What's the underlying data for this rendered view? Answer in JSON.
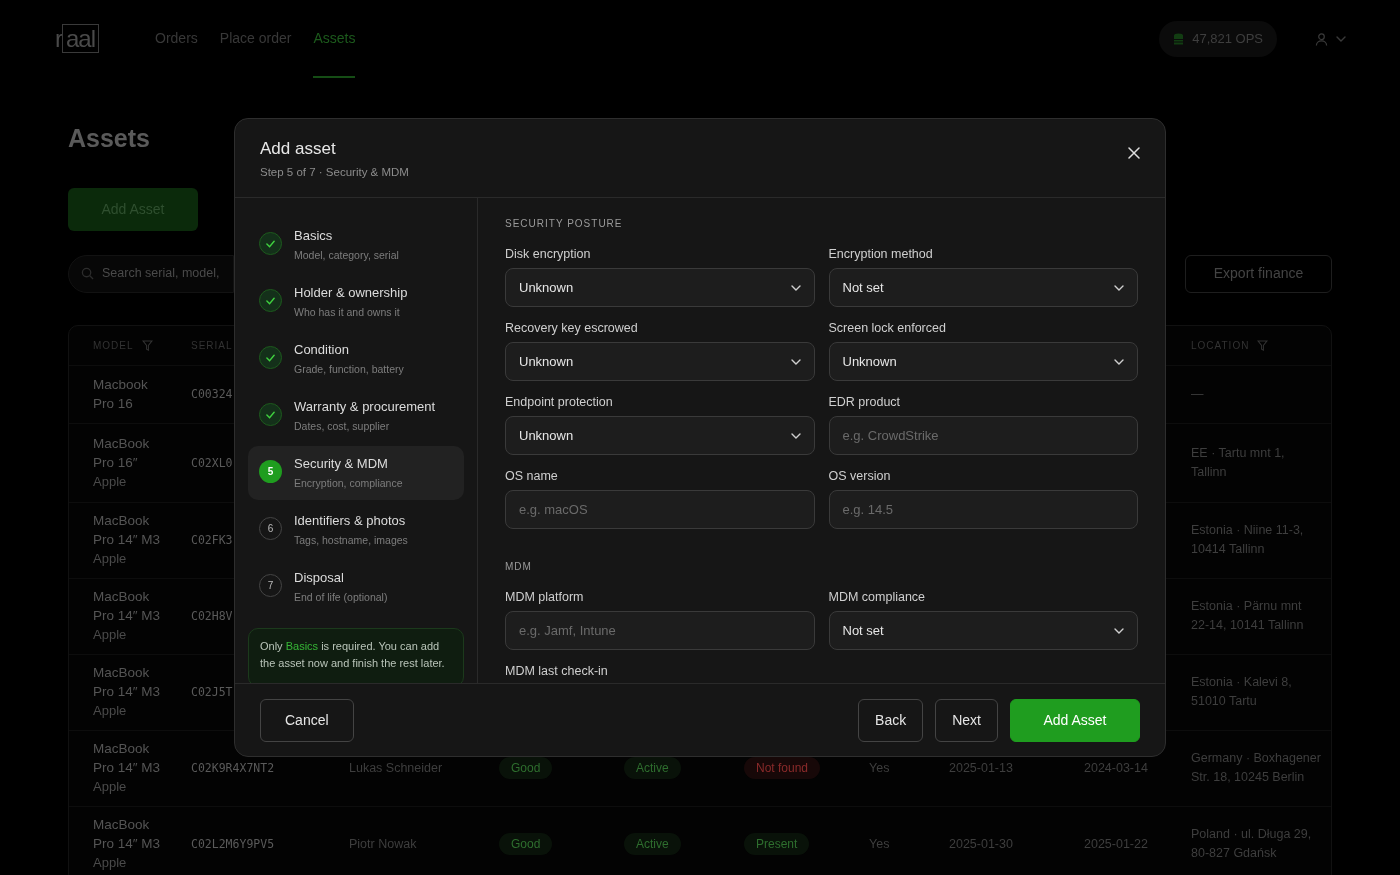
{
  "nav": {
    "logo": "raal",
    "links": [
      {
        "label": "Orders",
        "selected": false
      },
      {
        "label": "Place order",
        "selected": false
      },
      {
        "label": "Assets",
        "selected": true
      }
    ],
    "credits": "47,821 OPS"
  },
  "page": {
    "title": "Assets",
    "add_button": "Add Asset",
    "search_placeholder": "Search serial, model,",
    "export_button": "Export finance"
  },
  "table": {
    "columns": {
      "model": "MODEL",
      "serial": "SERIAL",
      "location": "LOCATION"
    },
    "rows": [
      {
        "model": "Macbook Pro 16",
        "serial": "C00324",
        "location": "—"
      },
      {
        "model": "MacBook Pro 16″",
        "vendor": "Apple",
        "serial": "C02XL0",
        "location": "EE · Tartu mnt 1, Tallinn"
      },
      {
        "model": "MacBook Pro 14″ M3",
        "vendor": "Apple",
        "serial": "C02FK3",
        "location": "Estonia · Niine 11-3, 10414 Tallinn"
      },
      {
        "model": "MacBook Pro 14″ M3",
        "vendor": "Apple",
        "serial": "C02H8V",
        "location": "Estonia · Pärnu mnt 22-14, 10141 Tallinn"
      },
      {
        "model": "MacBook Pro 14″ M3",
        "vendor": "Apple",
        "serial": "C02J5T",
        "location": "Estonia · Kalevi 8, 51010 Tartu"
      },
      {
        "model": "MacBook Pro 14″ M3",
        "vendor": "Apple",
        "serial": "C02K9R4X7NT2",
        "holder": "Lukas Schneider",
        "badges": [
          {
            "text": "Good",
            "color": "#2e6e2e"
          },
          {
            "text": "Active",
            "color": "#2e6e2e"
          },
          {
            "text": "Not found",
            "color": "#8a2a2a"
          }
        ],
        "mdm": "Yes",
        "date_1": "2025-01-13",
        "date_2": "2024-03-14",
        "location": "Germany · Boxhagener Str. 18, 10245 Berlin"
      },
      {
        "model": "MacBook Pro 14″ M3",
        "vendor": "Apple",
        "serial": "C02L2M6Y9PV5",
        "holder": "Piotr Nowak",
        "badges": [
          {
            "text": "Good",
            "color": "#2e6e2e"
          },
          {
            "text": "Active",
            "color": "#2e6e2e"
          },
          {
            "text": "Present",
            "color": "#2e6e2e"
          }
        ],
        "mdm": "Yes",
        "date_1": "2025-01-30",
        "date_2": "2025-01-22",
        "location": "Poland · ul. Długa 29, 80-827 Gdańsk"
      }
    ]
  },
  "modal": {
    "title": "Add asset",
    "subtitle": "Step 5 of 7 · Security & MDM",
    "steps": [
      {
        "title": "Basics",
        "description": "Model, category, serial",
        "completed": true,
        "selected": false
      },
      {
        "title": "Holder & ownership",
        "description": "Who has it and owns it",
        "completed": true,
        "selected": false
      },
      {
        "title": "Condition",
        "description": "Grade, function, battery",
        "completed": true,
        "selected": false
      },
      {
        "title": "Warranty & procurement",
        "description": "Dates, cost, supplier",
        "completed": true,
        "selected": false
      },
      {
        "title": "Security & MDM",
        "description": "Encryption, compliance",
        "completed": false,
        "selected": true,
        "number": "5"
      },
      {
        "title": "Identifiers & photos",
        "description": "Tags, hostname, images",
        "completed": false,
        "selected": false,
        "number": "6"
      },
      {
        "title": "Disposal",
        "description": "End of life (optional)",
        "completed": false,
        "selected": false,
        "number": "7"
      }
    ],
    "note": "Only **Basics** is required. You can add the asset now and finish the rest later.",
    "sections": [
      {
        "heading": "SECURITY POSTURE",
        "fields": [
          {
            "label": "Disk encryption",
            "kind": "select",
            "value": "Unknown"
          },
          {
            "label": "Encryption method",
            "kind": "select",
            "value": "Not set"
          },
          {
            "label": "Recovery key escrowed",
            "kind": "select",
            "value": "Unknown"
          },
          {
            "label": "Screen lock enforced",
            "kind": "select",
            "value": "Unknown"
          },
          {
            "label": "Endpoint protection",
            "kind": "select",
            "value": "Unknown"
          },
          {
            "label": "EDR product",
            "kind": "text",
            "placeholder": "e.g. CrowdStrike"
          },
          {
            "label": "OS name",
            "kind": "text",
            "placeholder": "e.g. macOS"
          },
          {
            "label": "OS version",
            "kind": "text",
            "placeholder": "e.g. 14.5"
          }
        ]
      },
      {
        "heading": "MDM",
        "fields": [
          {
            "label": "MDM platform",
            "kind": "text",
            "placeholder": "e.g. Jamf, Intune"
          },
          {
            "label": "MDM compliance",
            "kind": "select",
            "value": "Not set"
          },
          {
            "label": "MDM last check-in",
            "kind": "label"
          }
        ]
      }
    ],
    "footer": {
      "cancel": "Cancel",
      "back": "Back",
      "next": "Next",
      "submit": "Add Asset"
    }
  }
}
